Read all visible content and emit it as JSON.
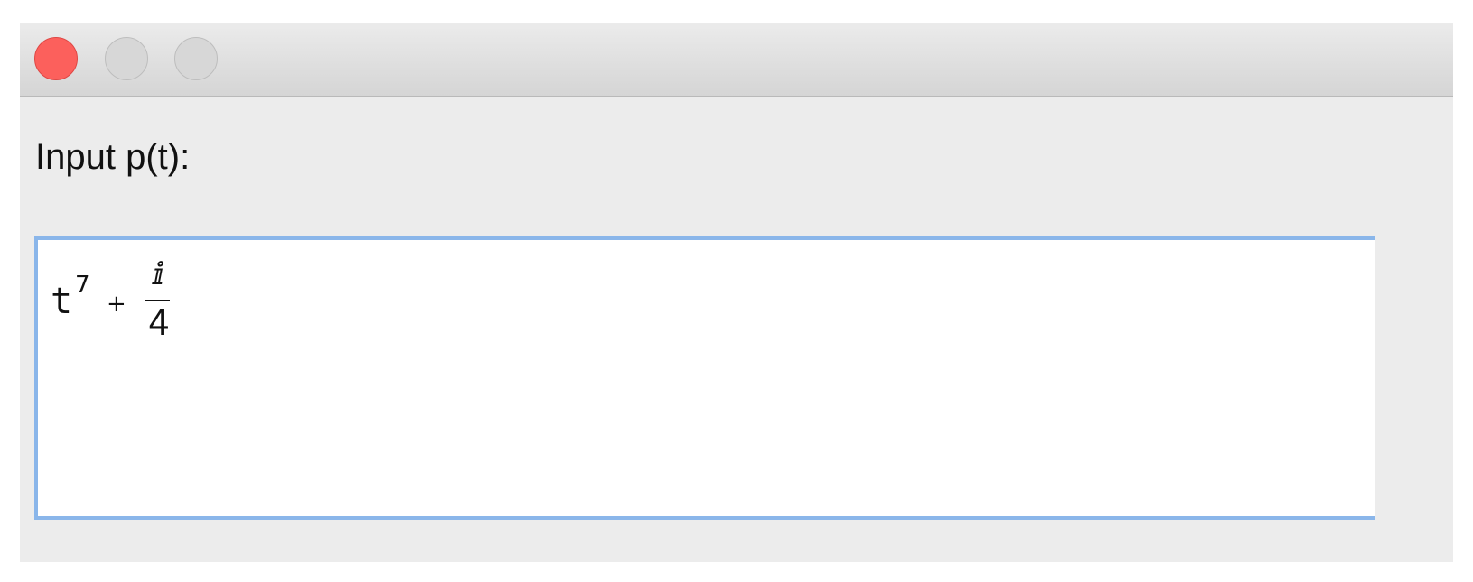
{
  "window": {
    "title_buttons": {
      "close": {
        "icon": "close-traffic-light",
        "color": "#fc605c"
      },
      "minimize": {
        "icon": "minimize-traffic-light",
        "color": "#d7d7d7"
      },
      "zoom": {
        "icon": "zoom-traffic-light",
        "color": "#d7d7d7"
      }
    }
  },
  "form": {
    "label": "Input p(t):",
    "input": {
      "focus_color": "#8ab6ea",
      "expression": {
        "base": "t",
        "exponent": "7",
        "operator": "+",
        "numerator": "ⅈ",
        "denominator": "4"
      }
    }
  }
}
